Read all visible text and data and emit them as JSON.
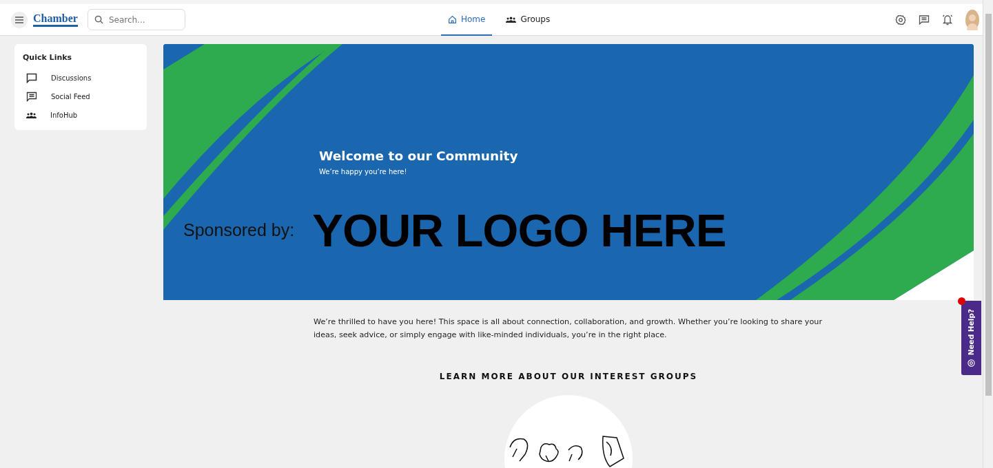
{
  "header": {
    "logo": "Chamber",
    "search": {
      "placeholder": "Search..."
    },
    "nav": [
      {
        "label": "Home",
        "selected": true
      },
      {
        "label": "Groups",
        "selected": false
      }
    ]
  },
  "sidebar": {
    "title": "Quick Links",
    "items": [
      {
        "label": "Discussions"
      },
      {
        "label": "Social Feed"
      },
      {
        "label": "InfoHub"
      }
    ]
  },
  "banner": {
    "title": "Welcome to our Community",
    "subtitle": "We’re happy you’re here!",
    "sponsor_label": "Sponsored by:",
    "sponsor_logo": "YOUR LOGO HERE"
  },
  "intro": "We’re thrilled to have you here! This space is all about connection, collaboration, and growth. Whether you’re looking to share your ideas, seek advice, or simply engage with like-minded individuals, you’re in the right place.",
  "section_title": "LEARN MORE ABOUT OUR INTEREST GROUPS",
  "help_tab": {
    "label": "Need Help?",
    "notification": true
  }
}
